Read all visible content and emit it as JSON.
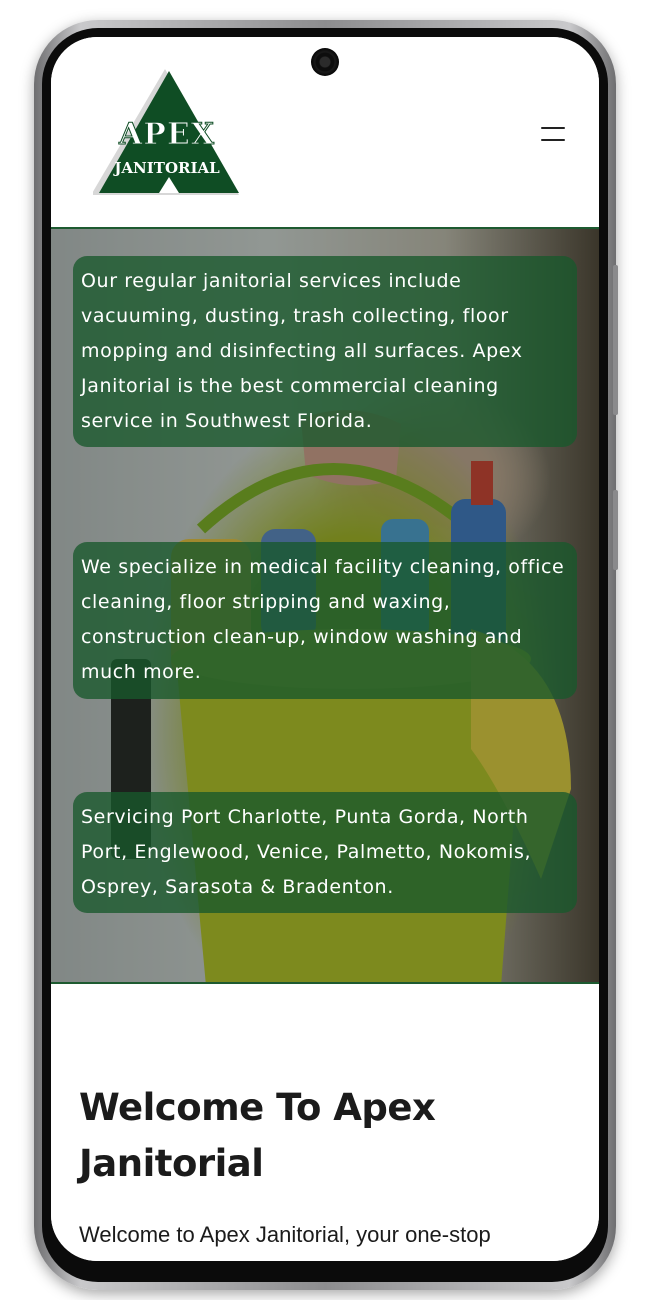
{
  "logo": {
    "line1": "APEX",
    "line2": "JANITORIAL"
  },
  "menu": {
    "icon": "hamburger-menu-icon"
  },
  "hero": {
    "paragraphs": [
      "Our regular janitorial services include vacuuming, dusting, trash collecting, floor mopping and disinfecting all surfaces. Apex Janitorial is the best commercial cleaning service in Southwest Florida.",
      "We specialize in medical facility cleaning, office cleaning, floor stripping and waxing, construction clean-up, window washing and much more.",
      "Servicing Port Charlotte, Punta Gorda, North Port, Englewood, Venice, Palmetto, Nokomis, Osprey, Sarasota & Bradenton."
    ]
  },
  "welcome": {
    "heading": "Welcome To Apex Janitorial",
    "intro": "Welcome to Apex Janitorial, your one-stop"
  },
  "colors": {
    "brand_green": "#0f4d24",
    "overlay_green": "#18582c"
  }
}
